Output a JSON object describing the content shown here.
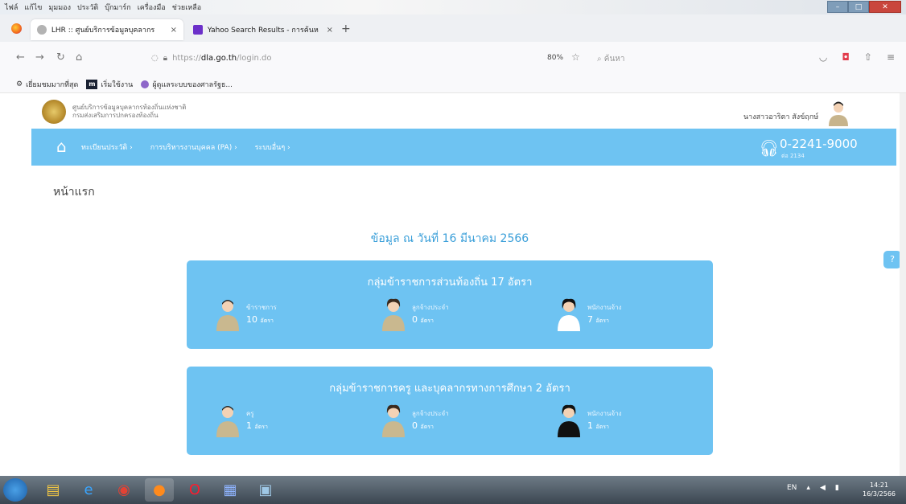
{
  "browser": {
    "menu": [
      "ไฟล์",
      "แก้ไข",
      "มุมมอง",
      "ประวัติ",
      "บุ๊กมาร์ก",
      "เครื่องมือ",
      "ช่วยเหลือ"
    ],
    "tabs": [
      {
        "title": "LHR :: ศูนย์บริการข้อมูลบุคลากร",
        "close": "×"
      },
      {
        "title": "Yahoo Search Results - การค้นหา",
        "close": "×"
      }
    ],
    "new_tab": "+",
    "url_prefix": "https://",
    "url_domain": "dla.go.th",
    "url_path": "/login.do",
    "zoom": "80%",
    "search_placeholder": "ค้นหา",
    "bookmarks": [
      "เยี่ยมชมมากที่สุด",
      "เริ่มใช้งาน",
      "ผู้ดูแลระบบของศาลรัฐธ..."
    ],
    "bookmark_m_icon": "m"
  },
  "site": {
    "org_line1": "ศูนย์บริการข้อมูลบุคลากรท้องถิ่นแห่งชาติ",
    "org_line2": "กรมส่งเสริมการปกครองท้องถิ่น",
    "user_name": "นางสาวอาริตา สังข์ฤกษ์",
    "menu": [
      "ทะเบียนประวัติ",
      "การบริหารงานบุคคล (PA)",
      "ระบบอื่นๆ"
    ],
    "phone": "0-2241-9000",
    "phone_ext": "ต่อ 2134",
    "accent": "#6ec3f2"
  },
  "main": {
    "page_title": "หน้าแรก",
    "date_line": "ข้อมูล ณ วันที่ 16 มีนาคม 2566",
    "groups": [
      {
        "title": "กลุ่มข้าราชการส่วนท้องถิ่น 17 อัตรา",
        "stats": [
          {
            "label": "ข้าราชการ",
            "value": "10",
            "unit": "อัตรา"
          },
          {
            "label": "ลูกจ้างประจำ",
            "value": "0",
            "unit": "อัตรา"
          },
          {
            "label": "พนักงานจ้าง",
            "value": "7",
            "unit": "อัตรา"
          }
        ]
      },
      {
        "title": "กลุ่มข้าราชการครู และบุคลากรทางการศึกษา 2 อัตรา",
        "stats": [
          {
            "label": "ครู",
            "value": "1",
            "unit": "อัตรา"
          },
          {
            "label": "ลูกจ้างประจำ",
            "value": "0",
            "unit": "อัตรา"
          },
          {
            "label": "พนักงานจ้าง",
            "value": "1",
            "unit": "อัตรา"
          }
        ]
      }
    ]
  },
  "taskbar": {
    "lang": "EN",
    "time": "14:21",
    "date": "16/3/2566"
  }
}
